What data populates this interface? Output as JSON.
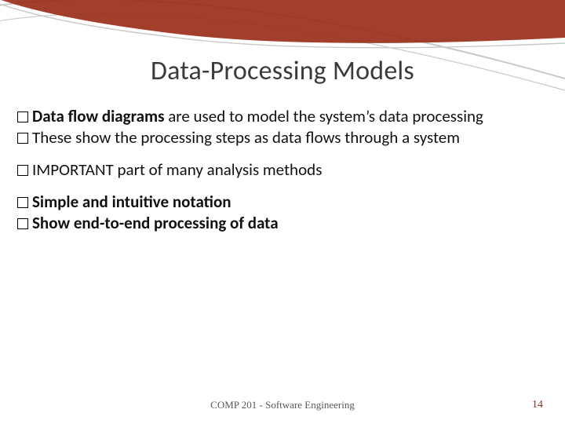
{
  "title": "Data-Processing Models",
  "groups": [
    [
      {
        "bold_prefix": "Data flow diagrams",
        "rest": " are used to model the system’s data processing"
      },
      {
        "bold_prefix": "",
        "rest": "These show the processing steps as data flows through a system"
      }
    ],
    [
      {
        "bold_prefix": "",
        "rest": "IMPORTANT part of many analysis methods"
      }
    ],
    [
      {
        "bold_prefix": "Simple and intuitive notation",
        "rest": ""
      },
      {
        "bold_prefix": "Show end-to-end processing of data",
        "rest": ""
      }
    ]
  ],
  "footer": {
    "center": "COMP 201 - Software Engineering",
    "page_number": "14"
  },
  "colors": {
    "accent_red": "#9a2e1a",
    "accent_grey": "#c9c9c9"
  }
}
